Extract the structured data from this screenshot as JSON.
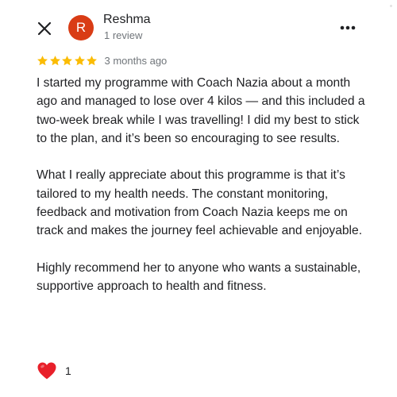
{
  "reviewer": {
    "initial": "R",
    "name": "Reshma",
    "review_count": "1 review",
    "avatar_color": "#d93c15"
  },
  "rating": {
    "stars": 5,
    "max_stars": 5,
    "star_color": "#fbbc04",
    "time": "3 months ago"
  },
  "review": {
    "paragraphs": [
      "I started my programme with Coach Nazia about a month ago and managed to lose over 4 kilos — and this included a two-week break while I was travelling! I did my best to stick to the plan, and it’s been so encouraging to see results.",
      "What I really appreciate about this programme is that it’s tailored to my health needs. The constant monitoring, feedback and motivation from Coach Nazia keeps me on track and makes the journey feel achievable and enjoyable.",
      "Highly recommend her to anyone who wants a sustainable, supportive approach to health and fitness."
    ]
  },
  "reactions": {
    "icon": "red-heart-icon",
    "count": "1",
    "heart_color": "#e8202a"
  },
  "icons": {
    "close": "close-icon",
    "more": "more-options-icon",
    "star": "star-icon"
  }
}
